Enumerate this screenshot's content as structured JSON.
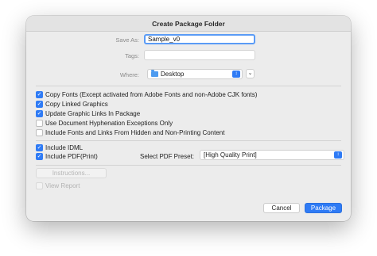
{
  "dialog": {
    "title": "Create Package Folder"
  },
  "form": {
    "save_as_label": "Save As:",
    "save_as_value": "Sample_v0",
    "tags_label": "Tags:",
    "tags_value": "",
    "where_label": "Where:",
    "where_value": "Desktop",
    "where_icon": "folder-icon",
    "stepper_icon": "up-down-chevron-icon",
    "expand_icon": "chevron-down-icon"
  },
  "options": [
    {
      "label": "Copy Fonts (Except activated from Adobe Fonts and non-Adobe CJK fonts)",
      "checked": true
    },
    {
      "label": "Copy Linked Graphics",
      "checked": true
    },
    {
      "label": "Update Graphic Links In Package",
      "checked": true
    },
    {
      "label": "Use Document Hyphenation Exceptions Only",
      "checked": false
    },
    {
      "label": "Include Fonts and Links From Hidden and Non-Printing Content",
      "checked": false
    }
  ],
  "export": {
    "include_idml_label": "Include IDML",
    "include_idml_checked": true,
    "include_pdf_label": "Include PDF(Print)",
    "include_pdf_checked": true,
    "pdf_preset_label": "Select PDF Preset:",
    "pdf_preset_value": "[High Quality Print]"
  },
  "extras": {
    "instructions_label": "Instructions...",
    "view_report_label": "View Report",
    "view_report_checked": false
  },
  "footer": {
    "cancel_label": "Cancel",
    "package_label": "Package"
  },
  "colors": {
    "accent": "#2f7bf5",
    "focus_ring": "#5a9bf6",
    "dialog_bg": "#ececec"
  }
}
